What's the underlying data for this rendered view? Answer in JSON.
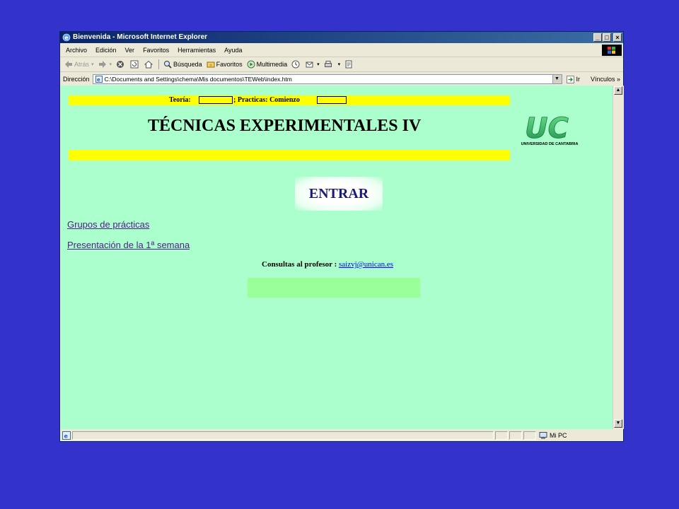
{
  "window": {
    "title": "Bienvenida - Microsoft Internet Explorer",
    "controls": {
      "minimize": "_",
      "maximize": "□",
      "close": "×"
    }
  },
  "menubar": {
    "items": [
      {
        "label": "Archivo",
        "accel": "A"
      },
      {
        "label": "Edición",
        "accel": "E"
      },
      {
        "label": "Ver",
        "accel": "V"
      },
      {
        "label": "Favoritos",
        "accel": "F"
      },
      {
        "label": "Herramientas",
        "accel": "H"
      },
      {
        "label": "Ayuda",
        "accel": "y"
      }
    ]
  },
  "toolbar": {
    "back_label": "Atrás",
    "search_label": "Búsqueda",
    "favorites_label": "Favoritos",
    "multimedia_label": "Multimedia"
  },
  "addressbar": {
    "label": "Dirección",
    "url": "C:\\Documents and Settings\\chema\\Mis documentos\\TEWeb\\index.htm",
    "go_label": "Ir",
    "links_label": "Vínculos"
  },
  "page": {
    "schedule_theory": "Teoría:",
    "schedule_practice": "; Practicas: Comienzo",
    "heading": "TÉCNICAS EXPERIMENTALES IV",
    "logo_text": "UC",
    "logo_subtitle": "UNIVERSIDAD DE CANTABRIA",
    "enter_button": "ENTRAR",
    "links": [
      "Grupos de prácticas",
      "Presentación de la 1ª semana"
    ],
    "contact_label": "Consultas al profesor :",
    "contact_email": "saizvj@unican.es"
  },
  "statusbar": {
    "zone": "Mi PC"
  },
  "colors": {
    "desktop": "#3333cc",
    "page_bg": "#aaffcc",
    "yellow_band": "#ffff00",
    "logo_green": "#33bb66"
  }
}
